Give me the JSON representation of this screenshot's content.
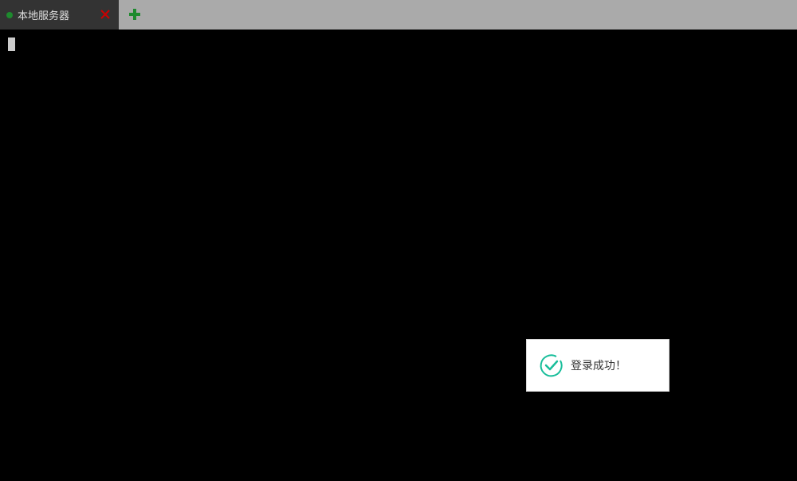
{
  "tabs": [
    {
      "label": "本地服务器",
      "status_color": "#1e8a2e",
      "close_icon": "close-icon",
      "close_color": "#cc0000"
    }
  ],
  "add_tab": {
    "icon": "plus-icon",
    "color": "#1e8a2e"
  },
  "terminal": {
    "background": "#000000",
    "cursor_color": "#cccccc"
  },
  "toast": {
    "message": "登录成功！",
    "icon": "check-circle-icon",
    "icon_color": "#19be9b"
  }
}
